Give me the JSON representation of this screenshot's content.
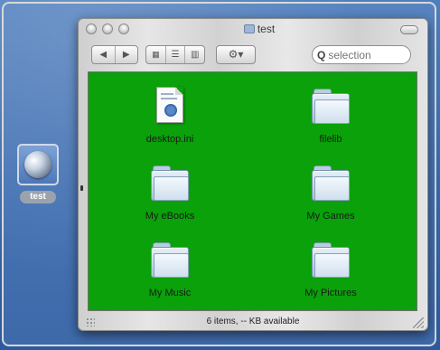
{
  "desktop": {
    "disk_label": "test"
  },
  "window": {
    "title": "test",
    "toolbar": {
      "back_icon": "back-arrow-icon",
      "forward_icon": "forward-arrow-icon",
      "view_icons": [
        "icon-view-icon",
        "list-view-icon",
        "column-view-icon"
      ],
      "action_icon": "gear-icon",
      "search_placeholder": "selection"
    },
    "items": [
      {
        "name": "desktop.ini",
        "type": "document"
      },
      {
        "name": "filelib",
        "type": "folder"
      },
      {
        "name": "My eBooks",
        "type": "folder"
      },
      {
        "name": "My Games",
        "type": "folder"
      },
      {
        "name": "My Music",
        "type": "folder"
      },
      {
        "name": "My Pictures",
        "type": "folder"
      }
    ],
    "status": "6 items, -- KB available",
    "content_background": "#0aa10a"
  }
}
